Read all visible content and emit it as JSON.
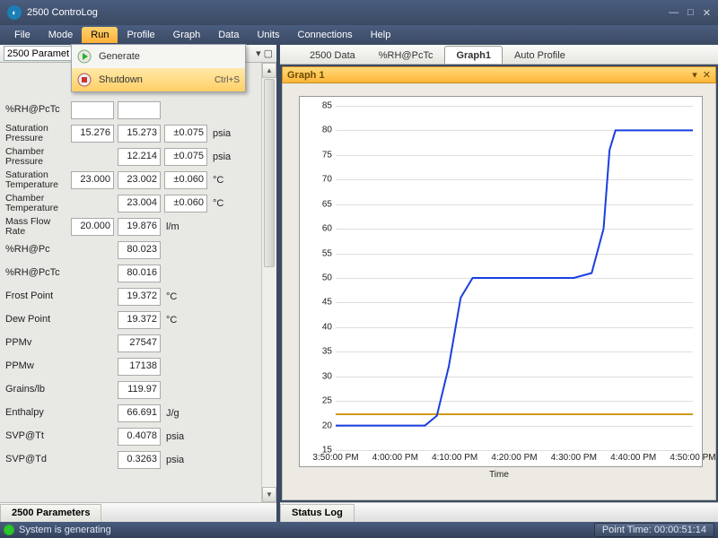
{
  "window": {
    "title": "2500 ControLog"
  },
  "menu": {
    "items": [
      "File",
      "Mode",
      "Run",
      "Profile",
      "Graph",
      "Data",
      "Units",
      "Connections",
      "Help"
    ],
    "active_index": 2
  },
  "run_menu": {
    "generate": "Generate",
    "shutdown": "Shutdown",
    "shutdown_shortcut": "Ctrl+S"
  },
  "left": {
    "combo": "2500 Paramet",
    "bottom_tab": "2500 Parameters",
    "rows": [
      {
        "label": "%RH@PcTc",
        "c1": "",
        "c2": "",
        "c3": "",
        "unit": "",
        "obscured": true
      },
      {
        "label": "Saturation Pressure",
        "c1": "15.276",
        "c2": "15.273",
        "c3": "±0.075",
        "unit": "psia",
        "two": true
      },
      {
        "label": "Chamber Pressure",
        "c2": "12.214",
        "c3": "±0.075",
        "unit": "psia",
        "two": true,
        "noc1": true
      },
      {
        "label": "Saturation Temperature",
        "c1": "23.000",
        "c2": "23.002",
        "c3": "±0.060",
        "unit": "°C",
        "two": true
      },
      {
        "label": "Chamber Temperature",
        "c2": "23.004",
        "c3": "±0.060",
        "unit": "°C",
        "two": true,
        "noc1": true
      },
      {
        "label": "Mass Flow Rate",
        "c1": "20.000",
        "c2": "19.876",
        "unit": "l/m",
        "two": true,
        "noc3": true
      },
      {
        "label": "%RH@Pc",
        "c2": "80.023",
        "indent": true
      },
      {
        "label": "%RH@PcTc",
        "c2": "80.016",
        "indent": true
      },
      {
        "label": "Frost Point",
        "c2": "19.372",
        "unit": "°C",
        "indent": true
      },
      {
        "label": "Dew Point",
        "c2": "19.372",
        "unit": "°C",
        "indent": true
      },
      {
        "label": "PPMv",
        "c2": "27547",
        "indent": true
      },
      {
        "label": "PPMw",
        "c2": "17138",
        "indent": true
      },
      {
        "label": "Grains/lb",
        "c2": "119.97",
        "indent": true
      },
      {
        "label": "Enthalpy",
        "c2": "66.691",
        "unit": "J/g",
        "indent": true
      },
      {
        "label": "SVP@Tt",
        "c2": "0.4078",
        "unit": "psia",
        "indent": true
      },
      {
        "label": "SVP@Td",
        "c2": "0.3263",
        "unit": "psia",
        "indent": true
      }
    ]
  },
  "right": {
    "tabs": [
      "2500 Data",
      "%RH@PcTc",
      "Graph1",
      "Auto Profile"
    ],
    "active_tab": 2,
    "graph_title": "Graph 1",
    "bottom_tab": "Status Log",
    "xlabel": "Time"
  },
  "status": {
    "msg": "System is generating",
    "point_time": "Point Time:  00:00:51:14"
  },
  "chart_data": {
    "type": "line",
    "title": "Graph 1",
    "xlabel": "Time",
    "ylabel": "",
    "ylim": [
      15,
      85
    ],
    "x_ticks": [
      "3:50:00 PM",
      "4:00:00 PM",
      "4:10:00 PM",
      "4:20:00 PM",
      "4:30:00 PM",
      "4:40:00 PM",
      "4:50:00 PM"
    ],
    "y_ticks": [
      15,
      20,
      25,
      30,
      35,
      40,
      45,
      50,
      55,
      60,
      65,
      70,
      75,
      80,
      85
    ],
    "reference_line": 22.5,
    "reference_color": "#d49a1a",
    "series": [
      {
        "name": "%RH@PcTc",
        "color": "#1a3fe0",
        "x": [
          "3:50:00 PM",
          "4:05:00 PM",
          "4:07:00 PM",
          "4:09:00 PM",
          "4:11:00 PM",
          "4:13:00 PM",
          "4:30:00 PM",
          "4:33:00 PM",
          "4:35:00 PM",
          "4:36:00 PM",
          "4:37:00 PM",
          "4:50:00 PM"
        ],
        "y": [
          20,
          20,
          22,
          32,
          46,
          50,
          50,
          51,
          60,
          76,
          80,
          80
        ]
      }
    ]
  }
}
